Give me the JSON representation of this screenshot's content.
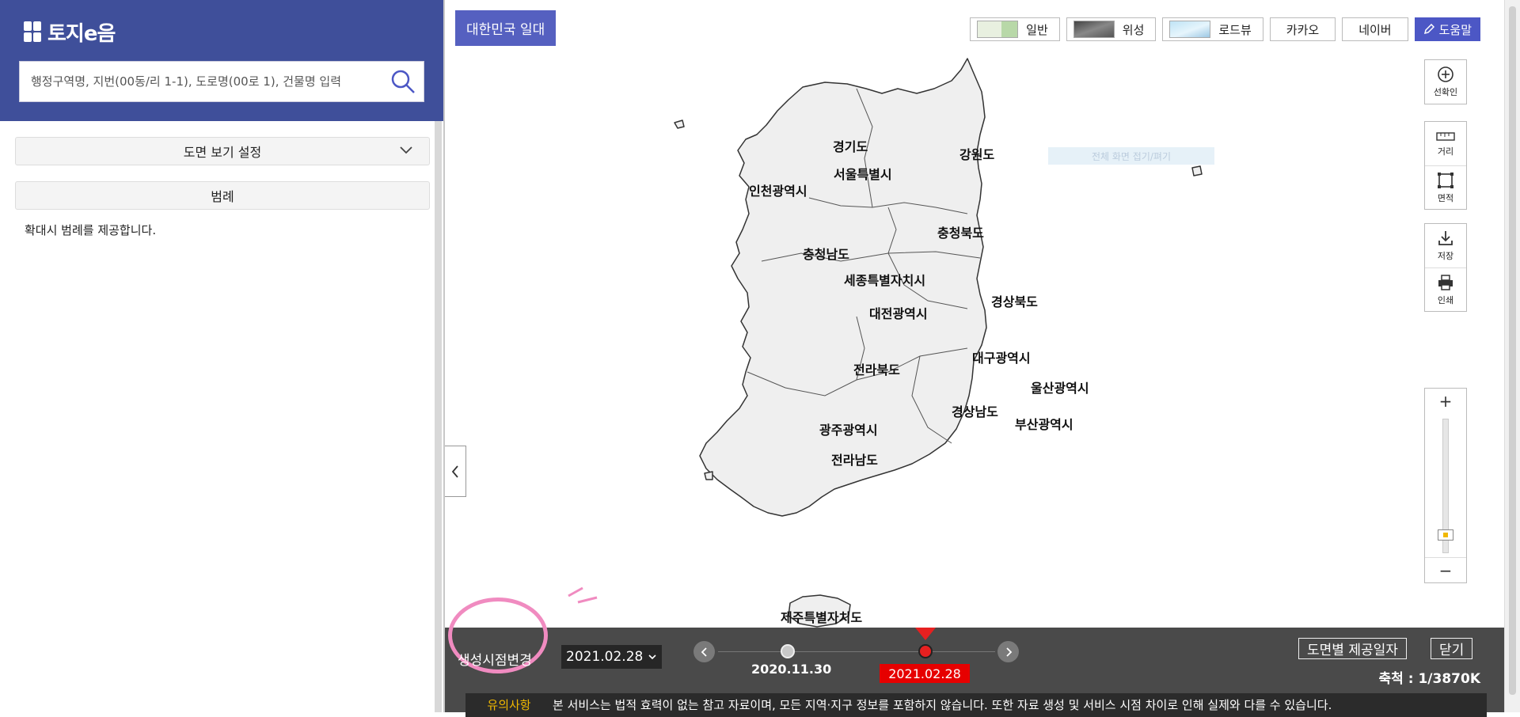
{
  "app": {
    "logo_text": "토지e음"
  },
  "search": {
    "placeholder": "행정구역명, 지번(00동/리 1-1), 도로명(00로 1), 건물명 입력"
  },
  "left_panel": {
    "view_settings_label": "도면 보기 설정",
    "legend_label": "범례",
    "legend_note": "확대시 범례를 제공합니다."
  },
  "map": {
    "region_tag": "대한민국 일대",
    "map_types": [
      {
        "label": "일반"
      },
      {
        "label": "위성"
      },
      {
        "label": "로드뷰"
      },
      {
        "label": "카카오"
      },
      {
        "label": "네이버"
      }
    ],
    "help_label": "도움말",
    "tools": {
      "select": "선확인",
      "distance": "거리",
      "area": "면적",
      "save": "저장",
      "print": "인쇄"
    },
    "zoom": {
      "in": "+",
      "out": "−",
      "level": 0.12
    },
    "hint": "전체 화면 접기/펴기",
    "regions": [
      {
        "name": "경기도"
      },
      {
        "name": "서울특별시"
      },
      {
        "name": "인천광역시"
      },
      {
        "name": "강원도"
      },
      {
        "name": "충청북도"
      },
      {
        "name": "충청남도"
      },
      {
        "name": "세종특별자치시"
      },
      {
        "name": "대전광역시"
      },
      {
        "name": "경상북도"
      },
      {
        "name": "대구광역시"
      },
      {
        "name": "전라북도"
      },
      {
        "name": "울산광역시"
      },
      {
        "name": "경상남도"
      },
      {
        "name": "부산광역시"
      },
      {
        "name": "광주광역시"
      },
      {
        "name": "전라남도"
      },
      {
        "name": "제주특별자치도"
      }
    ],
    "colors": {
      "land": "#efefef",
      "border": "#333333",
      "accent": "#4c57c5"
    }
  },
  "timeline": {
    "label": "생성시점변경",
    "selected_date": "2021.02.28",
    "dates": [
      {
        "label": "2020.11.30"
      },
      {
        "label": "2021.02.28"
      }
    ],
    "provide_date_btn": "도면별 제공일자",
    "close_btn": "닫기",
    "scale": "축척 : 1/3870K",
    "notice_title": "유의사항",
    "notice_text": "본 서비스는 법적 효력이 없는 참고 자료이며, 모든 지역·지구 정보를 포함하지 않습니다. 또한 자료 생성 및 서비스 시점 차이로 인해 실제와 다를 수 있습니다."
  }
}
